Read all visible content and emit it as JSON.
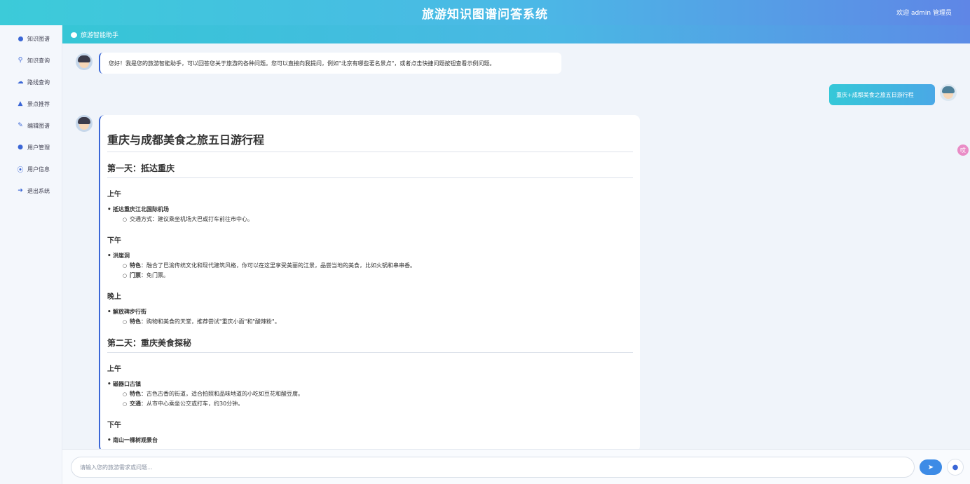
{
  "header": {
    "title": "旅游知识图谱问答系统",
    "welcome": "欢迎 admin 管理员"
  },
  "sidebar": {
    "items": [
      {
        "label": "知识图谱",
        "icon": "circle-icon"
      },
      {
        "label": "知识查询",
        "icon": "search-icon"
      },
      {
        "label": "路线查询",
        "icon": "route-icon"
      },
      {
        "label": "景点推荐",
        "icon": "thumbs-up-icon"
      },
      {
        "label": "编辑图谱",
        "icon": "edit-icon"
      },
      {
        "label": "用户管理",
        "icon": "users-icon"
      },
      {
        "label": "用户信息",
        "icon": "user-info-icon"
      },
      {
        "label": "退出系统",
        "icon": "logout-icon"
      }
    ]
  },
  "chat": {
    "header_label": "旅游智能助手",
    "greeting": "您好！我是您的旅游智能助手，可以回答您关于旅游的各种问题。您可以直接向我提问，例如\"北京有哪些著名景点\"，或者点击快捷问题按钮查看示例问题。",
    "user_message": "重庆+成都美食之旅五日游行程",
    "answer": {
      "title": "重庆与成都美食之旅五日游行程",
      "day1": {
        "heading": "第一天：抵达重庆",
        "morning": {
          "label": "上午",
          "place": "抵达重庆江北国际机场",
          "detail": "交通方式：建议乘坐机场大巴或打车前往市中心。"
        },
        "afternoon": {
          "label": "下午",
          "place": "洪崖洞",
          "feature_key": "特色",
          "feature": "：融合了巴渝传统文化和现代建筑风格，你可以在这里享受美丽的江景，品尝当地的美食，比如火锅和串串香。",
          "ticket_key": "门票",
          "ticket": "：免门票。"
        },
        "evening": {
          "label": "晚上",
          "place": "解放碑步行街",
          "feature_key": "特色",
          "feature": "：购物和美食的天堂，推荐尝试\"重庆小面\"和\"酸辣粉\"。"
        }
      },
      "day2": {
        "heading": "第二天：重庆美食探秘",
        "morning": {
          "label": "上午",
          "place": "磁器口古镇",
          "feature_key": "特色",
          "feature": "：古色古香的街道，适合拍照和品味地道的小吃如豆花和酸豆腐。",
          "transport_key": "交通",
          "transport": "：从市中心乘坐公交或打车，约30分钟。"
        },
        "afternoon": {
          "label": "下午",
          "place": "南山一棵树观景台"
        }
      }
    }
  },
  "input": {
    "placeholder": "请输入您的旅游需求或问题..."
  },
  "float_badge": "哎"
}
